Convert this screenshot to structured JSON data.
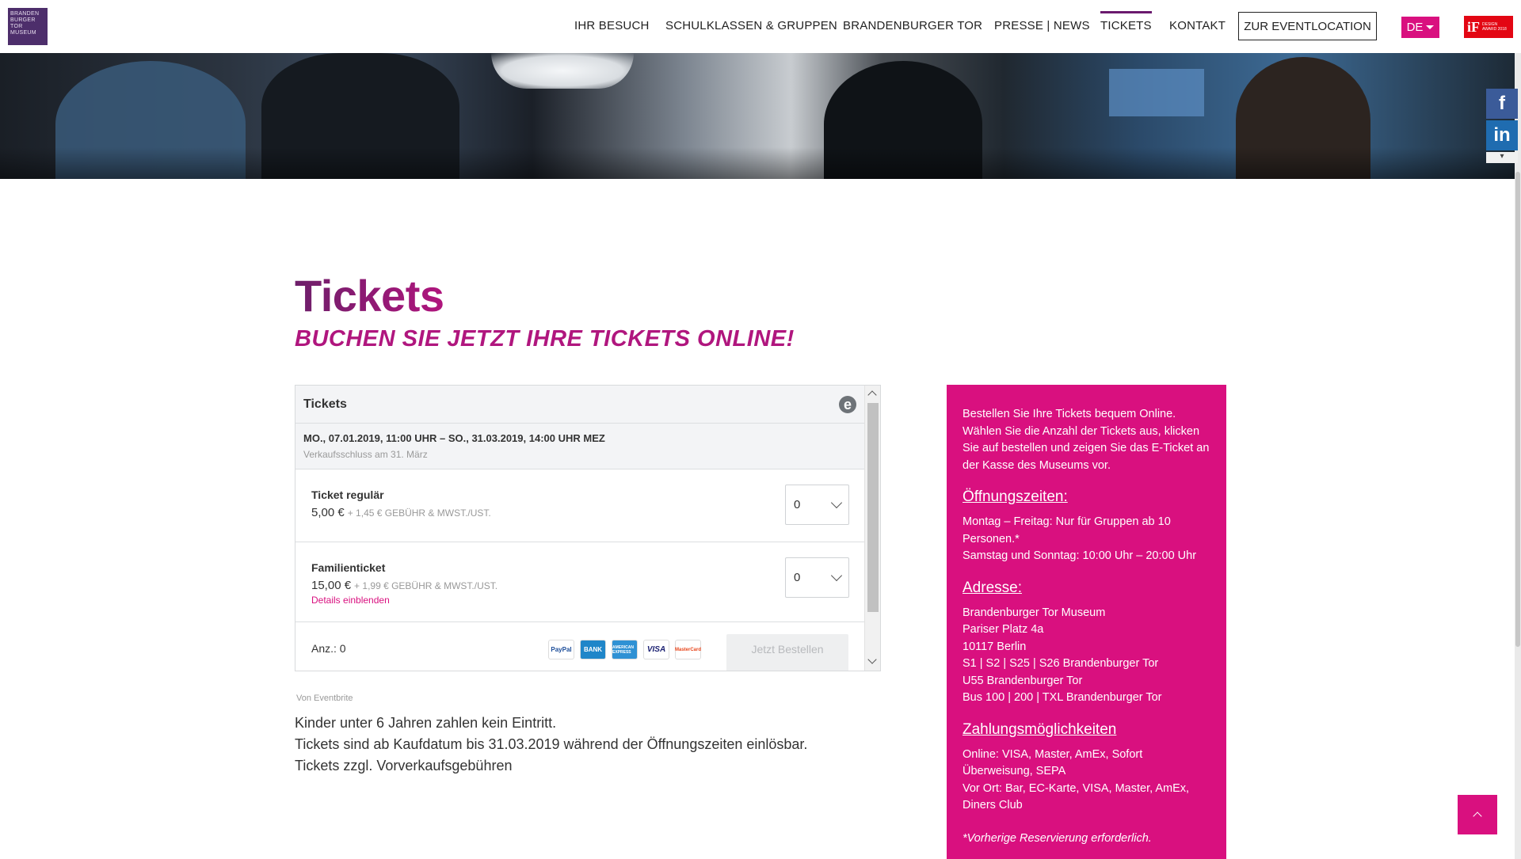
{
  "logo": {
    "lines": [
      "BRANDEN",
      "BURGER",
      "TOR",
      "MUSEUM"
    ]
  },
  "nav": {
    "items": [
      "IHR BESUCH",
      "SCHULKLASSEN & GRUPPEN",
      "BRANDENBURGER TOR",
      "PRESSE | NEWS",
      "TICKETS",
      "KONTAKT"
    ],
    "active": "TICKETS",
    "event_button": "ZUR EVENTLOCATION",
    "language": "DE",
    "award_mark": "iF",
    "award_text": "DESIGN AWARD 2018"
  },
  "social": {
    "facebook": "f",
    "linkedin": "in"
  },
  "page": {
    "title": "Tickets",
    "subtitle": "BUCHEN SIE JETZT IHRE TICKETS ONLINE!"
  },
  "widget": {
    "header": "Tickets",
    "date_range": "MO., 07.01.2019, 11:00 UHR – SO., 31.03.2019, 14:00 UHR MEZ",
    "sale_end": "Verkaufsschluss am 31. März",
    "tickets": [
      {
        "name": "Ticket regulär",
        "price": "5,00 €",
        "fee": "+ 1,45 € GEBÜHR & MWST./UST.",
        "qty": "0"
      },
      {
        "name": "Familienticket",
        "price": "15,00 €",
        "fee": "+ 1,99 € GEBÜHR & MWST./UST.",
        "qty": "0",
        "details": "Details einblenden"
      }
    ],
    "count": "Anz.: 0",
    "payment_icons": [
      "PayPal",
      "BANK",
      "AMERICAN EXPRESS",
      "VISA",
      "MasterCard"
    ],
    "order_button": "Jetzt Bestellen",
    "by": "Von Eventbrite"
  },
  "notes": [
    "Kinder unter 6 Jahren zahlen kein Eintritt.",
    "Tickets sind ab Kaufdatum bis 31.03.2019 während der Öffnungszeiten einlösbar.",
    "Tickets zzgl. Vorverkaufsgebühren"
  ],
  "info": {
    "intro": "Bestellen Sie Ihre Tickets bequem Online. Wählen Sie die Anzahl der Tickets aus, klicken Sie auf bestellen und zeigen Sie das E-Ticket an der Kasse des Museums vor.",
    "hours_title": "Öffnungszeiten:",
    "hours_lines": [
      "Montag – Freitag: Nur für Gruppen ab 10 Personen.*",
      "Samstag und Sonntag: 10:00 Uhr – 20:00 Uhr"
    ],
    "address_title": "Adresse:",
    "address_lines": [
      "Brandenburger Tor Museum",
      "Pariser Platz 4a",
      "10117 Berlin",
      "S1 | S2 | S25 | S26 Brandenburger Tor",
      "U55 Brandenburger Tor",
      "Bus 100 | 200 | TXL Brandenburger Tor"
    ],
    "payment_title": "Zahlungsmöglichkeiten",
    "payment_lines": [
      "Online: VISA, Master, AmEx, Sofort Überweisung, SEPA",
      "Vor Ort: Bar, EC-Karte, VISA, Master, AmEx, Diners Club"
    ],
    "footnote": "*Vorherige Reservierung erforderlich."
  },
  "colors": {
    "accent": "#d9107f",
    "title": "#7a1a6e",
    "nav_active": "#6a1a6e"
  }
}
